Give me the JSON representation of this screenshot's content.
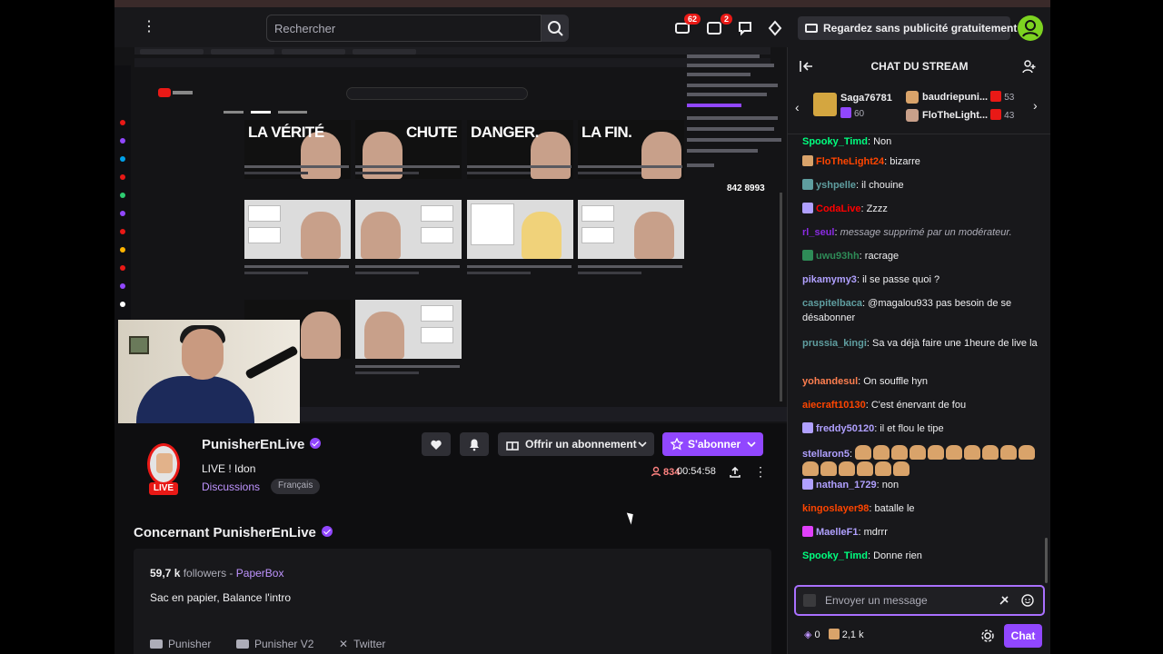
{
  "nav": {
    "search_placeholder": "Rechercher",
    "notifications_count": "62",
    "inbox_count": "2",
    "adfree_label": "Regardez sans publicité gratuitement"
  },
  "stream_overlay": {
    "thumb_texts": [
      "LA VÉRITÉ",
      "CHUTE",
      "DANGER.",
      "LA FIN."
    ],
    "counter": "842 8993"
  },
  "channel": {
    "name": "PunisherEnLive",
    "live_label": "LIVE",
    "title": "LIVE ! Idon",
    "category": "Discussions",
    "language": "Français",
    "viewers": "834",
    "uptime": "00:54:58",
    "gift_label": "Offrir un abonnement",
    "subscribe_label": "S'abonner"
  },
  "about": {
    "title": "Concernant PunisherEnLive",
    "followers_count": "59,7 k",
    "followers_label": "followers",
    "team_sep": "-",
    "team": "PaperBox",
    "bio": "Sac en papier, Balance l'intro",
    "socials": [
      "Punisher",
      "Punisher V2",
      "Twitter"
    ]
  },
  "chat": {
    "title": "CHAT DU STREAM",
    "gifts": [
      {
        "name": "Saga76781",
        "count": "60"
      },
      {
        "name": "baudriepuni...",
        "count": "53"
      },
      {
        "name": "FloTheLight...",
        "count": "43"
      }
    ],
    "messages": [
      {
        "user": "Spooky_Timd",
        "color": "#00ff7f",
        "text": "Non"
      },
      {
        "user": "FloTheLight24",
        "color": "#ff4500",
        "text": "bizarre"
      },
      {
        "user": "yshpelle",
        "color": "#5f9ea0",
        "text": "il chouine"
      },
      {
        "user": "CodaLive",
        "color": "#ff0000",
        "text": "Zzzz"
      },
      {
        "user": "rl_seul",
        "color": "#8a2be2",
        "text": "message supprimé par un modérateur."
      },
      {
        "user": "uwu93hh",
        "color": "#2e8b57",
        "text": "racrage"
      },
      {
        "user": "pikamymy3",
        "color": "#b0a0ff",
        "text": "il se passe quoi ?"
      },
      {
        "user": "caspitelbaca",
        "color": "#5f9ea0",
        "text": "@magalou933 pas besoin de se désabonner"
      },
      {
        "user": "prussia_kingi",
        "color": "#5f9ea0",
        "text": "Sa va déjà faire une 1heure de live la"
      },
      {
        "user": "yohandesul",
        "color": "#ff7f50",
        "text": "On souffle hyn"
      },
      {
        "user": "aiecraft10130",
        "color": "#ff4500",
        "text": "C'est énervant de fou"
      },
      {
        "user": "freddy50120",
        "color": "#b0a0ff",
        "text": "il et flou le tipe"
      },
      {
        "user": "stellaron5",
        "color": "#b0a0ff",
        "text": ""
      },
      {
        "user": "nathan_1729",
        "color": "#b0a0ff",
        "text": "non"
      },
      {
        "user": "kingoslayer98",
        "color": "#ff4500",
        "text": "batalle le"
      },
      {
        "user": "MaelleF1",
        "color": "#b0a0ff",
        "text": "mdrrr"
      },
      {
        "user": "Spooky_Timd",
        "color": "#00ff7f",
        "text": "Donne rien"
      }
    ],
    "input_placeholder": "Envoyer un message",
    "points": "0",
    "bits": "2,1 k",
    "send_label": "Chat"
  },
  "colors": {
    "accent": "#9147ff",
    "live": "#e91916",
    "bg": "#0e0e10",
    "panel": "#18181b"
  }
}
